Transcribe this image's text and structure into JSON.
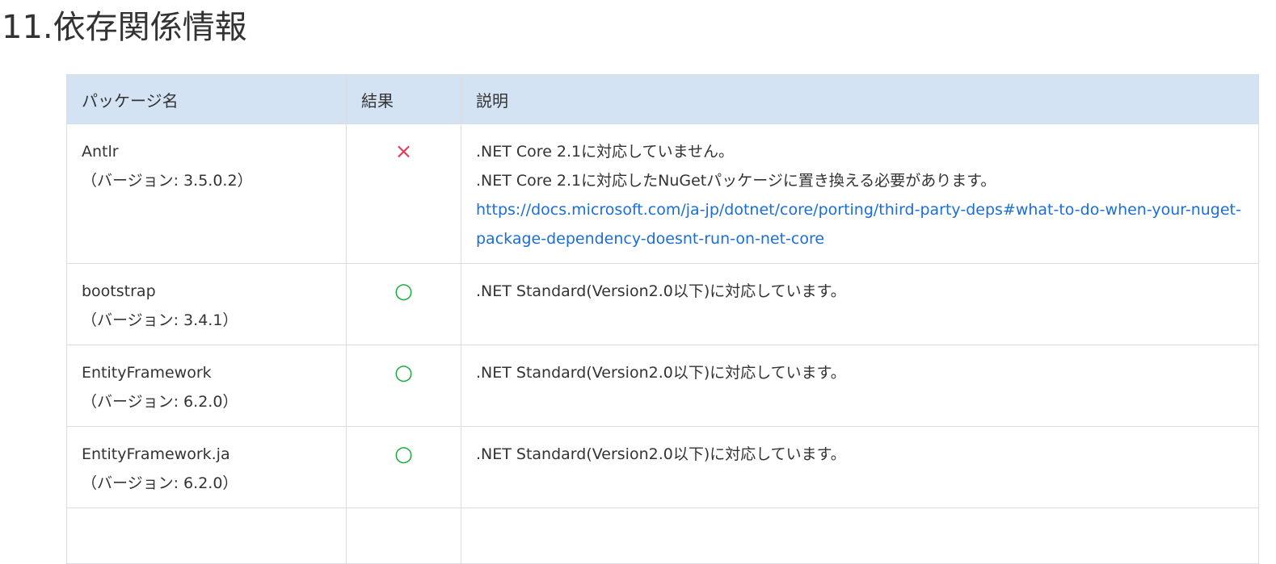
{
  "page": {
    "title": "11.依存関係情報"
  },
  "table": {
    "headers": {
      "package": "パッケージ名",
      "result": "結果",
      "description": "説明"
    },
    "rows": [
      {
        "name": "Antlr",
        "version": "（バージョン: 3.5.0.2）",
        "result_mark": "×",
        "result": "ng",
        "desc_line1": ".NET Core 2.1に対応していません。",
        "desc_line2": ".NET Core 2.1に対応したNuGetパッケージに置き換える必要があります。",
        "link": "https://docs.microsoft.com/ja-jp/dotnet/core/porting/third-party-deps#what-to-do-when-your-nuget-package-dependency-doesnt-run-on-net-core"
      },
      {
        "name": "bootstrap",
        "version": "（バージョン: 3.4.1）",
        "result_mark": "○",
        "result": "ok",
        "desc_line1": ".NET Standard(Version2.0以下)に対応しています。"
      },
      {
        "name": "EntityFramework",
        "version": "（バージョン: 6.2.0）",
        "result_mark": "○",
        "result": "ok",
        "desc_line1": ".NET Standard(Version2.0以下)に対応しています。"
      },
      {
        "name": "EntityFramework.ja",
        "version": "（バージョン: 6.2.0）",
        "result_mark": "○",
        "result": "ok",
        "desc_line1": ".NET Standard(Version2.0以下)に対応しています。"
      }
    ]
  },
  "colors": {
    "header_bg": "#d4e3f3",
    "ng": "#e0405a",
    "ok": "#1aaa3c",
    "link": "#1a6ed8"
  }
}
